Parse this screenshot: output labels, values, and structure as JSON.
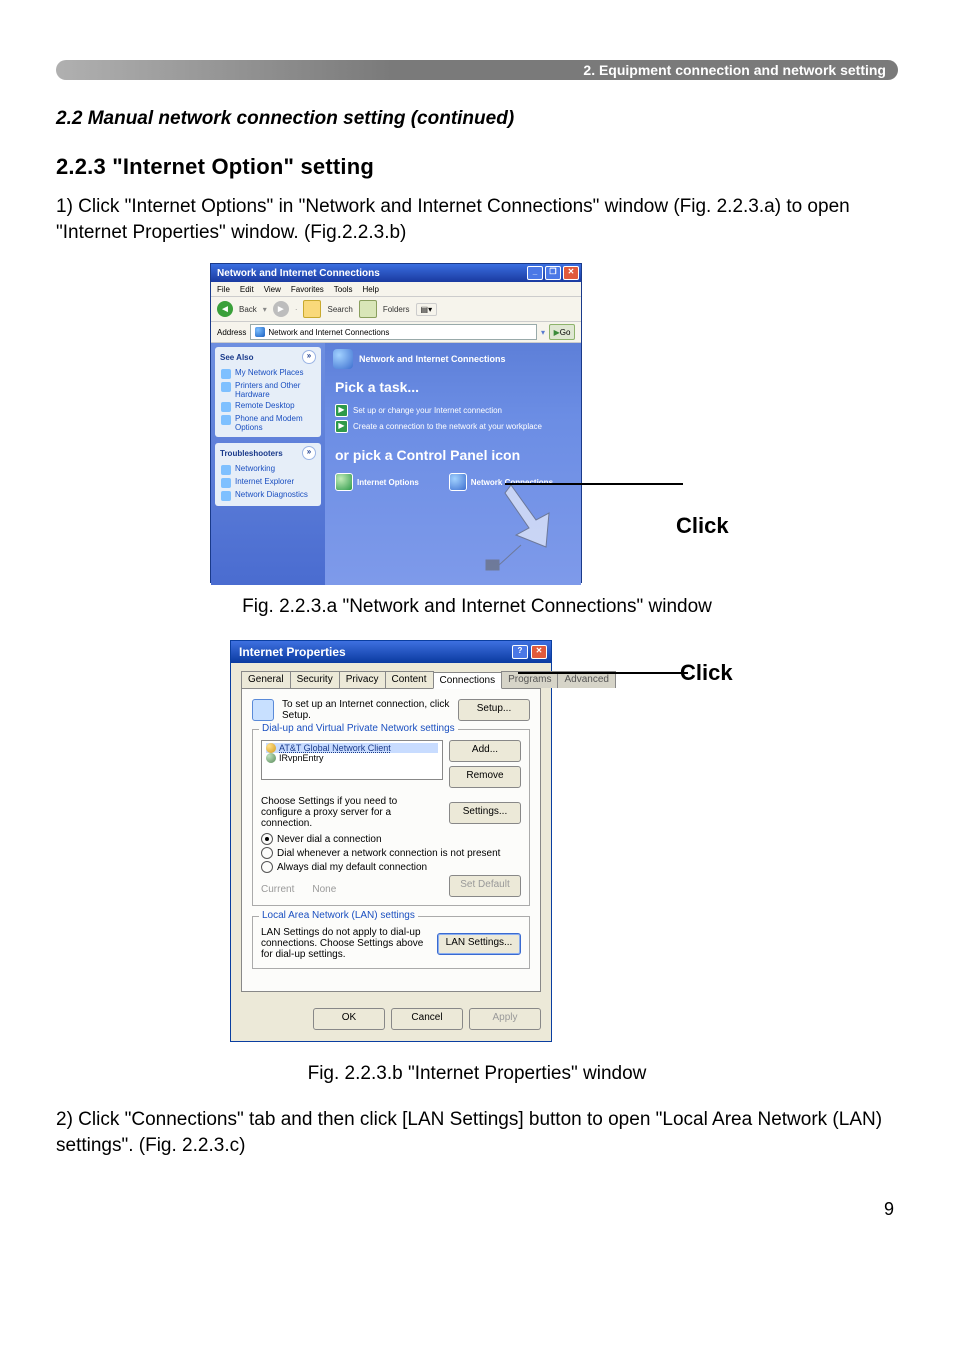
{
  "header": {
    "bar": "2. Equipment connection and network setting"
  },
  "titles": {
    "section": "2.2 Manual network connection setting (continued)",
    "subsection": "2.2.3 \"Internet Option\" setting"
  },
  "body": {
    "p1": "1) Click \"Internet Options\" in \"Network and Internet Connections\" window (Fig. 2.2.3.a) to open \"Internet Properties\" window. (Fig.2.2.3.b)",
    "caption_a": "Fig. 2.2.3.a \"Network and Internet Connections\" window",
    "caption_b": "Fig. 2.2.3.b \"Internet Properties\" window",
    "p2": "2) Click \"Connections\" tab and then click [LAN Settings] button to open \"Local Area Network (LAN) settings\". (Fig. 2.2.3.c)",
    "pagenum": "9"
  },
  "callouts": {
    "click": "Click"
  },
  "fig_a": {
    "title": "Network and Internet Connections",
    "window_min": "_",
    "window_max": "❐",
    "window_close": "✕",
    "menu": {
      "file": "File",
      "edit": "Edit",
      "view": "View",
      "favorites": "Favorites",
      "tools": "Tools",
      "help": "Help"
    },
    "toolbar": {
      "back": "Back",
      "search": "Search",
      "folders": "Folders"
    },
    "address_label": "Address",
    "address_value": "Network and Internet Connections",
    "go": "Go",
    "left1_head": "See Also",
    "left1_items": [
      "My Network Places",
      "Printers and Other Hardware",
      "Remote Desktop",
      "Phone and Modem Options"
    ],
    "left2_head": "Troubleshooters",
    "left2_items": [
      "Networking",
      "Internet Explorer",
      "Network Diagnostics"
    ],
    "cat_header": "Network and Internet Connections",
    "pick_task": "Pick a task...",
    "task1": "Set up or change your Internet connection",
    "task2": "Create a connection to the network at your workplace",
    "or_pick": "or pick a Control Panel icon",
    "cp1": "Internet Options",
    "cp2": "Network Connections"
  },
  "fig_b": {
    "title": "Internet Properties",
    "help_btn": "?",
    "close_btn": "✕",
    "tabs": {
      "general": "General",
      "security": "Security",
      "privacy": "Privacy",
      "content": "Content",
      "connections": "Connections",
      "programs": "Programs",
      "advanced": "Advanced"
    },
    "row1_text": "To set up an Internet connection, click Setup.",
    "setup_btn": "Setup...",
    "group1_legend": "Dial-up and Virtual Private Network settings",
    "dialup_items": [
      "AT&T Global Network Client",
      "IRvpnEntry"
    ],
    "add_btn": "Add...",
    "remove_btn": "Remove",
    "choose_text": "Choose Settings if you need to configure a proxy server for a connection.",
    "settings_btn": "Settings...",
    "radios": {
      "never": "Never dial a connection",
      "when": "Dial whenever a network connection is not present",
      "always": "Always dial my default connection"
    },
    "current_label": "Current",
    "current_value": "None",
    "setdefault_btn": "Set Default",
    "group2_legend": "Local Area Network (LAN) settings",
    "lan_text": "LAN Settings do not apply to dial-up connections. Choose Settings above for dial-up settings.",
    "lan_btn": "LAN Settings...",
    "ok": "OK",
    "cancel": "Cancel",
    "apply": "Apply"
  }
}
